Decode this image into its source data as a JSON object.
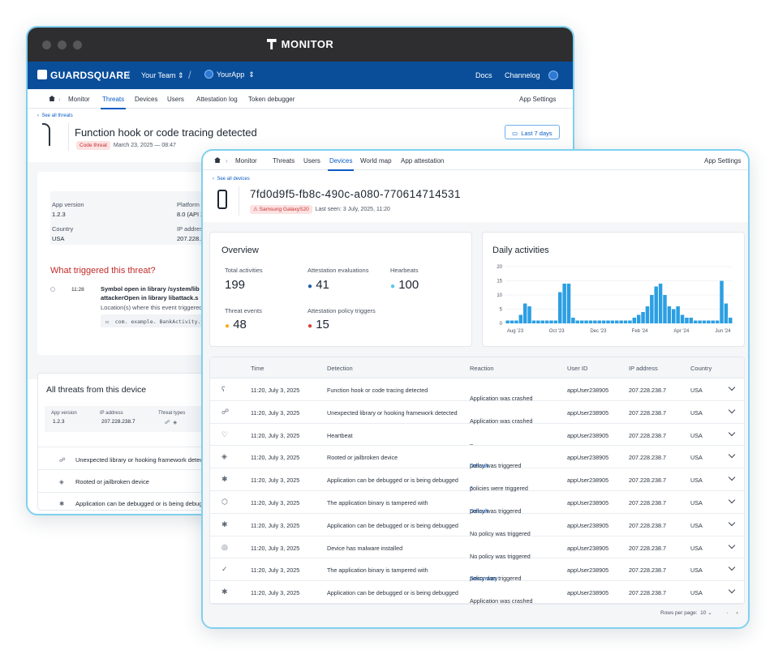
{
  "back": {
    "title": "MONITOR",
    "brand": "GUARDSQUARE",
    "team": "Your Team",
    "app": "YourApp",
    "docs": "Docs",
    "changelog": "Channelog",
    "nav": [
      "Monitor",
      "Threats",
      "Devices",
      "Users",
      "Attestation log",
      "Token debugger"
    ],
    "app_settings": "App Settings",
    "see_all": "See all threats",
    "heading": "Function hook or code tracing detected",
    "badge": "Code threat",
    "date": "March 23, 2025 — 08:47",
    "range": "Last 7 days",
    "app_version_label": "App version",
    "app_version": "1.2.3",
    "platform_label": "Platform",
    "platform": "8.0 (API 2",
    "country_label": "Country",
    "country": "USA",
    "ip_label": "IP address",
    "ip": "207.228.2",
    "triggered_title": "What triggered this threat?",
    "time": "11:28",
    "event_line1": "Symbol open in library /system/lib",
    "event_line2": "attackerOpen in library libattack.s",
    "event_line3": "Location(s) where this event triggered",
    "code": "com. example. BankActivity.tra",
    "all_threats": "All threats from this device",
    "mini": {
      "app_version_label": "App version",
      "app_version": "1.2.3",
      "ip_label": "IP address",
      "ip": "207.228.238.7",
      "types_label": "Threat types"
    },
    "list": [
      "Unexpected library or hooking framework detect",
      "Rooted or jailbroken device",
      "Application can be debugged or is being debugge"
    ]
  },
  "front": {
    "nav": [
      "Monitor",
      "Threats",
      "Users",
      "Devices",
      "World map",
      "App attestation"
    ],
    "app_settings": "App Settings",
    "see_all": "See all devices",
    "device_id": "7fd0d9f5-fb8c-490c-a080-770614714531",
    "device_badge": "Samsung GalaxyS20",
    "last_seen": "Last seen: 3 July, 2025, 11:20",
    "overview": {
      "title": "Overview",
      "stats": [
        {
          "label": "Total activities",
          "value": "199",
          "color": ""
        },
        {
          "label": "Attestation evaluations",
          "value": "41",
          "color": "#1d5fa8"
        },
        {
          "label": "Hearbeats",
          "value": "100",
          "color": "#5bc3ea"
        },
        {
          "label": "Threat events",
          "value": "48",
          "color": "#f4b323"
        },
        {
          "label": "Attestation policy triggers",
          "value": "15",
          "color": "#d64232"
        }
      ]
    },
    "daily": {
      "title": "Daily activities"
    },
    "table": {
      "headers": [
        "Time",
        "Detection",
        "Reaction",
        "User ID",
        "IP address",
        "Country"
      ],
      "rows": [
        {
          "time": "11:20, July 3, 2025",
          "detection": "Function hook or code tracing detected",
          "reaction_pre": "",
          "reaction_link": "",
          "reaction": "Application was crashed",
          "user": "appUser238905",
          "ip": "207.228.238.7",
          "country": "USA",
          "icon": "hook-icon"
        },
        {
          "time": "11:20, July 3, 2025",
          "detection": "Unexpected library or hooking framework detected",
          "reaction_pre": "",
          "reaction_link": "",
          "reaction": "Application was crashed",
          "user": "appUser238905",
          "ip": "207.228.238.7",
          "country": "USA",
          "icon": "puzzle-icon"
        },
        {
          "time": "11:20, July 3, 2025",
          "detection": "Heartbeat",
          "reaction_pre": "",
          "reaction_link": "",
          "reaction": "–",
          "user": "appUser238905",
          "ip": "207.228.238.7",
          "country": "USA",
          "icon": "heart-icon"
        },
        {
          "time": "11:20, July 3, 2025",
          "detection": "Rooted or jailbroken device",
          "reaction_pre": "",
          "reaction_link": "Default",
          "reaction": " policy was triggered",
          "user": "appUser238905",
          "ip": "207.228.238.7",
          "country": "USA",
          "icon": "root-icon"
        },
        {
          "time": "11:20, July 3, 2025",
          "detection": "Application can be debugged or is being debugged",
          "reaction_pre": "",
          "reaction_link": "6",
          "reaction": " policies were triggered",
          "user": "appUser238905",
          "ip": "207.228.238.7",
          "country": "USA",
          "icon": "bug-icon"
        },
        {
          "time": "11:20, July 3, 2025",
          "detection": "The application binary is tampered with",
          "reaction_pre": "",
          "reaction_link": "Default",
          "reaction": " policy was triggered",
          "user": "appUser238905",
          "ip": "207.228.238.7",
          "country": "USA",
          "icon": "box-icon"
        },
        {
          "time": "11:20, July 3, 2025",
          "detection": "Application can be debugged or is being debugged",
          "reaction_pre": "",
          "reaction_link": "",
          "reaction": "No policy was triggered",
          "user": "appUser238905",
          "ip": "207.228.238.7",
          "country": "USA",
          "icon": "bug-icon"
        },
        {
          "time": "11:20, July 3, 2025",
          "detection": "Device has malware installed",
          "reaction_pre": "",
          "reaction_link": "",
          "reaction": "No policy was triggered",
          "user": "appUser238905",
          "ip": "207.228.238.7",
          "country": "USA",
          "icon": "malware-icon"
        },
        {
          "time": "11:20, July 3, 2025",
          "detection": "The application binary is tampered with",
          "reaction_pre": "",
          "reaction_link": "Secondary",
          "reaction": " policy was triggered",
          "user": "appUser238905",
          "ip": "207.228.238.7",
          "country": "USA",
          "icon": "check-icon"
        },
        {
          "time": "11:20, July 3, 2025",
          "detection": "Application can be debugged or is being debugged",
          "reaction_pre": "",
          "reaction_link": "",
          "reaction": "Application was crashed",
          "user": "appUser238905",
          "ip": "207.228.238.7",
          "country": "USA",
          "icon": "bug-icon"
        }
      ]
    },
    "rows_per_page_label": "Rows per page:",
    "rows_per_page": "10"
  },
  "chart_data": {
    "type": "bar",
    "title": "Daily activities",
    "x_tick_labels": [
      "Aug '23",
      "Oct '23",
      "Dec '23",
      "Feb '24",
      "Apr '24",
      "Jun '24"
    ],
    "ylim": [
      0,
      20
    ],
    "y_ticks": [
      0,
      5,
      10,
      15,
      20
    ],
    "color": "#2b9fe3",
    "values": [
      1,
      1,
      1,
      3,
      7,
      6,
      1,
      1,
      1,
      1,
      1,
      1,
      11,
      14,
      14,
      2,
      1,
      1,
      1,
      1,
      1,
      1,
      1,
      1,
      1,
      1,
      1,
      1,
      1,
      2,
      3,
      4,
      6,
      10,
      13,
      14,
      10,
      6,
      5,
      6,
      3,
      2,
      2,
      1,
      1,
      1,
      1,
      1,
      1,
      15,
      7,
      2
    ]
  }
}
